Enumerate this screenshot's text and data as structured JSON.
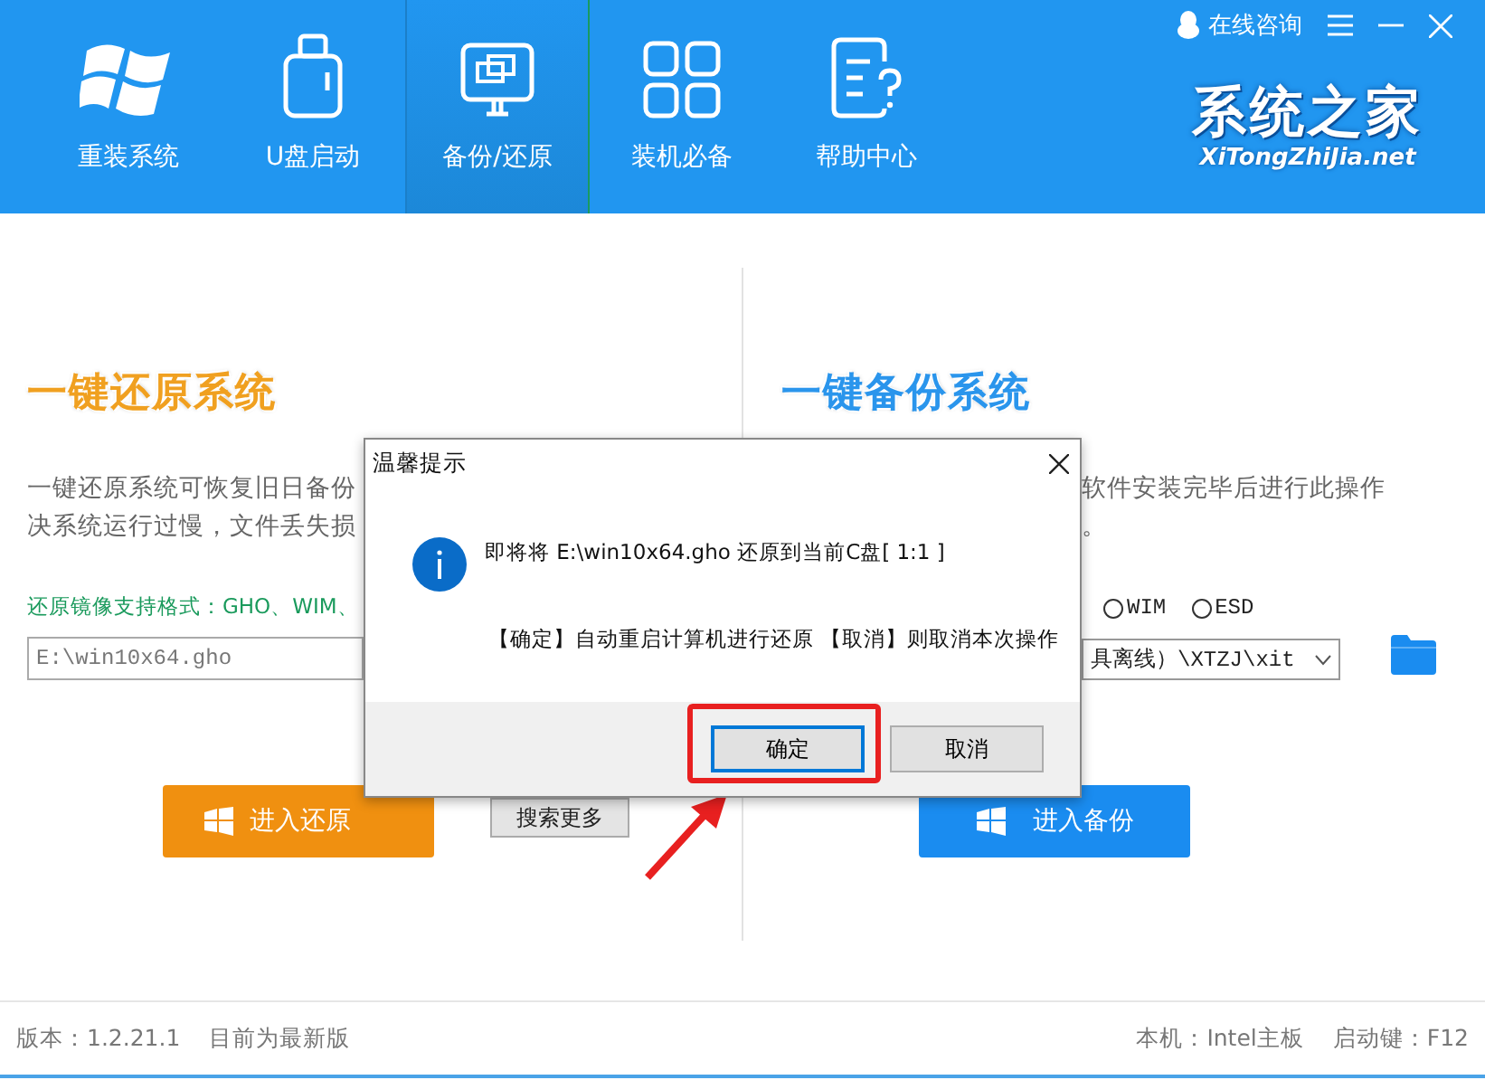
{
  "header": {
    "tabs": [
      {
        "label": "重装系统",
        "selected": false
      },
      {
        "label": "U盘启动",
        "selected": false
      },
      {
        "label": "备份/还原",
        "selected": true
      },
      {
        "label": "装机必备",
        "selected": false
      },
      {
        "label": "帮助中心",
        "selected": false
      }
    ],
    "consult": "在线咨询",
    "logo": {
      "name": "系统之家",
      "url": "XiTongZhiJia.net"
    }
  },
  "restore": {
    "title": "一键还原系统",
    "description": [
      "一键还原系统可恢复旧日备份",
      "决系统运行过慢，文件丢失损"
    ],
    "formats": "还原镜像支持格式：GHO、WIM、",
    "path": "E:\\win10x64.gho",
    "button": "进入还原",
    "search_button": "搜索更多"
  },
  "backup": {
    "title": "一键备份系统",
    "description": [
      "软件安装完毕后进行此操作",
      "。"
    ],
    "formats": [
      {
        "label": "WIM",
        "selected": false
      },
      {
        "label": "ESD",
        "selected": false
      }
    ],
    "path": "具离线）\\XTZJ\\xit",
    "button": "进入备份"
  },
  "dialog": {
    "title": "温馨提示",
    "message": "即将将 E:\\win10x64.gho 还原到当前C盘[ 1:1 ]",
    "hint": "【确定】自动重启计算机进行还原 【取消】则取消本次操作",
    "buttons": [
      {
        "label": "确定",
        "selected": true
      },
      {
        "label": "取消",
        "selected": false
      }
    ]
  },
  "status_bar": {
    "version": "版本：1.2.21.1",
    "update": "目前为最新版",
    "board": "本机：Intel主板",
    "hotkey": "启动键：F12"
  }
}
